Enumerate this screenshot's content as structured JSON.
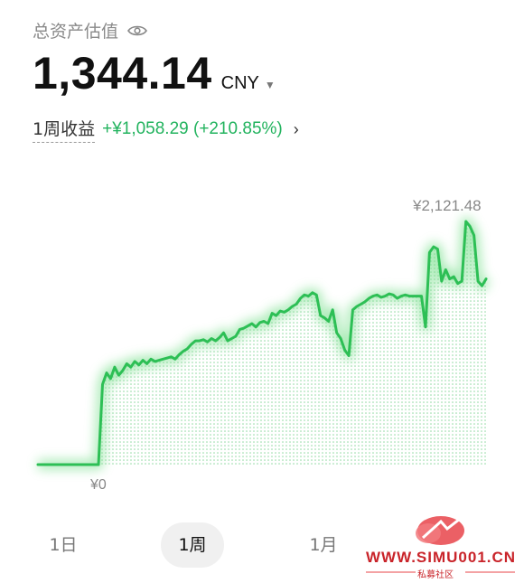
{
  "header": {
    "title": "总资产估值",
    "eye_icon": "eye-icon"
  },
  "balance": {
    "value": "1,344.14",
    "currency": "CNY",
    "dropdown_icon": "caret-down-icon"
  },
  "pnl": {
    "label": "1周收益",
    "value": "+¥1,058.29 (+210.85%)",
    "chevron_icon": "chevron-right-icon"
  },
  "chart_labels": {
    "max": "¥2,121.48",
    "min": "¥0"
  },
  "tabs": [
    {
      "label": "1日",
      "active": false
    },
    {
      "label": "1周",
      "active": true
    },
    {
      "label": "1月",
      "active": false
    }
  ],
  "watermark": {
    "text": "WWW.SIMU001.CN",
    "sub": "私募社区"
  },
  "colors": {
    "accent": "#22b35e",
    "line": "#2dbf55",
    "glow": "#7be08f"
  },
  "chart_data": {
    "type": "area",
    "title": "",
    "xlabel": "",
    "ylabel": "",
    "ylim": [
      0,
      2121.48
    ],
    "series": [
      {
        "values": [
          0,
          0,
          0,
          0,
          0,
          0,
          0,
          0,
          0,
          0,
          0,
          0,
          0,
          0,
          0,
          0,
          700,
          800,
          750,
          850,
          780,
          820,
          880,
          850,
          900,
          870,
          910,
          880,
          920,
          900,
          910,
          920,
          930,
          940,
          920,
          960,
          990,
          1010,
          1050,
          1080,
          1080,
          1090,
          1070,
          1100,
          1080,
          1110,
          1150,
          1080,
          1100,
          1120,
          1180,
          1190,
          1210,
          1230,
          1200,
          1240,
          1250,
          1230,
          1320,
          1300,
          1340,
          1330,
          1350,
          1380,
          1400,
          1450,
          1480,
          1470,
          1500,
          1480,
          1300,
          1280,
          1250,
          1350,
          1150,
          1100,
          1000,
          950,
          1350,
          1380,
          1400,
          1420,
          1450,
          1470,
          1480,
          1460,
          1470,
          1490,
          1480,
          1450,
          1470,
          1480,
          1470,
          1470,
          1470,
          1470,
          1200,
          1850,
          1900,
          1880,
          1600,
          1700,
          1620,
          1640,
          1580,
          1600,
          2121.48,
          2080,
          2000,
          1600,
          1560,
          1620
        ]
      }
    ]
  }
}
